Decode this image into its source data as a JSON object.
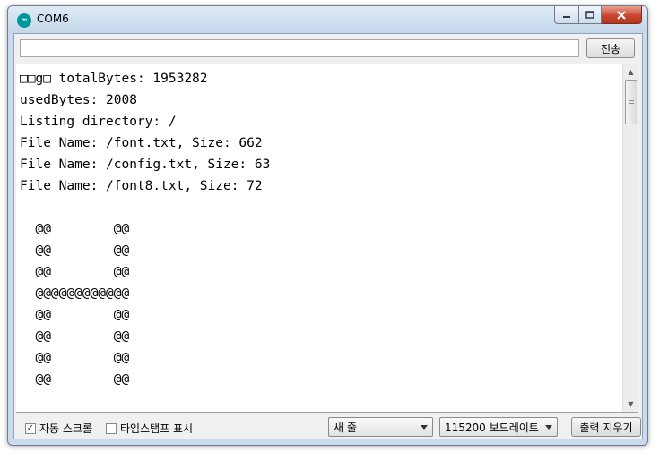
{
  "window": {
    "title": "COM6",
    "icon": "arduino-infinity-icon",
    "controls": [
      "minimize-icon",
      "maximize-icon",
      "close-icon"
    ]
  },
  "toolbar": {
    "send_input_value": "",
    "send_label": "전송"
  },
  "serial_output": {
    "lines": [
      "□□g□ totalBytes: 1953282",
      "usedBytes: 2008",
      "Listing directory: /",
      "File Name: /font.txt, Size: 662",
      "File Name: /config.txt, Size: 63",
      "File Name: /font8.txt, Size: 72",
      "",
      "  @@        @@",
      "  @@        @@",
      "  @@        @@",
      "  @@@@@@@@@@@@",
      "  @@        @@",
      "  @@        @@",
      "  @@        @@",
      "  @@        @@"
    ]
  },
  "bottom_bar": {
    "autoscroll_label": "자동 스크롤",
    "autoscroll_checked": true,
    "timestamp_label": "타임스탬프 표시",
    "timestamp_checked": false,
    "line_ending_selected": "새 줄",
    "baud_selected": "115200 보드레이트",
    "clear_label": "출력 지우기"
  },
  "colors": {
    "app_icon": "#00979c",
    "title_bar": "#c9dcee",
    "close_button": "#c9452e"
  }
}
